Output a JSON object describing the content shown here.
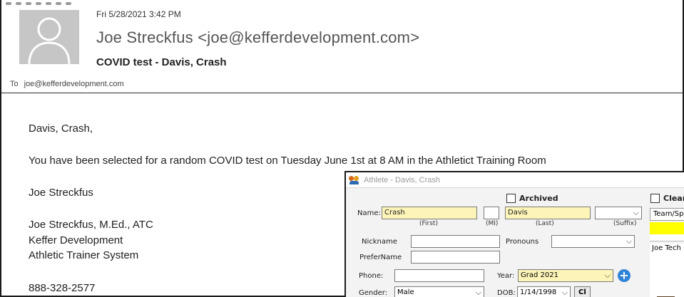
{
  "email": {
    "sent_date": "Fri 5/28/2021 3:42 PM",
    "sender": "Joe Streckfus <joe@kefferdevelopment.com>",
    "subject": "COVID test - Davis, Crash",
    "to_label": "To",
    "to_address": "joe@kefferdevelopment.com",
    "body": {
      "greeting": "Davis, Crash,",
      "message": "You have been selected for a random COVID test on Tuesday June 1st at 8 AM in the Athletict Training Room",
      "signoff": "Joe Streckfus",
      "sig_name": "Joe Streckfus, M.Ed., ATC",
      "sig_company": "Keffer Development",
      "sig_product": "Athletic Trainer System",
      "sig_phone": "888-328-2577"
    }
  },
  "athlete_window": {
    "title": "Athlete - Davis, Crash",
    "archived_label": "Archived",
    "archived_checked": false,
    "clear_label": "Clear",
    "clear_checked": false,
    "name_label": "Name:",
    "first_value": "Crash",
    "mi_value": "",
    "last_value": "Davis",
    "suffix_value": "",
    "first_caption": "(First)",
    "mi_caption": "(MI)",
    "last_caption": "(Last)",
    "suffix_caption": "(Suffix)",
    "nickname_label": "Nickname",
    "nickname_value": "",
    "pronouns_label": "Pronouns",
    "pronouns_value": "",
    "prefername_label": "PreferName",
    "prefername_value": "",
    "phone_label": "Phone:",
    "phone_value": "",
    "year_label": "Year:",
    "year_value": "Grad 2021",
    "gender_label": "Gender:",
    "gender_value": "Male",
    "dob_label": "DOB:",
    "dob_value": "1/14/1998",
    "cl_button": "Cl",
    "team_header": "Team/Sp",
    "team_row": "Joe Tech",
    "add_icon": "plus-circle-icon",
    "highlight_color": "#fdf5b8",
    "accent_color": "#2f84d8"
  }
}
